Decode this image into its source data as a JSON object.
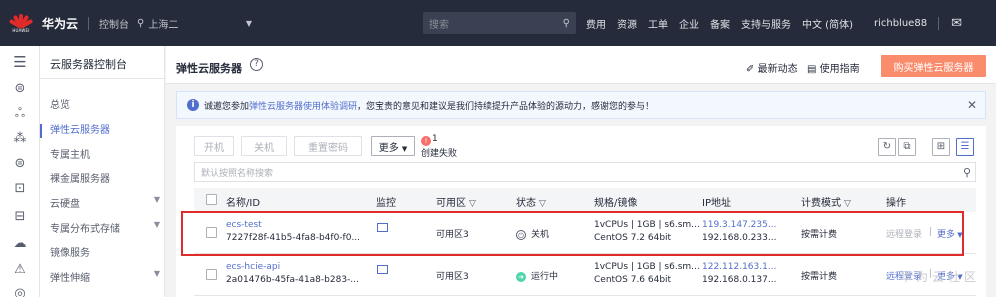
{
  "topbar": {
    "brand": "华为云",
    "console": "控制台",
    "region": "上海二",
    "search_placeholder": "搜索",
    "nav": [
      "费用",
      "资源",
      "工单",
      "企业",
      "备案",
      "支持与服务",
      "中文 (简体)"
    ],
    "user": "richblue88"
  },
  "sidebar": {
    "title": "云服务器控制台",
    "items": [
      {
        "label": "总览",
        "expandable": false
      },
      {
        "label": "弹性云服务器",
        "expandable": false
      },
      {
        "label": "专属主机",
        "expandable": false
      },
      {
        "label": "裸金属服务器",
        "expandable": false
      },
      {
        "label": "云硬盘",
        "expandable": true
      },
      {
        "label": "专属分布式存储",
        "expandable": true
      },
      {
        "label": "镜像服务",
        "expandable": false
      },
      {
        "label": "弹性伸缩",
        "expandable": true
      }
    ]
  },
  "header": {
    "title": "弹性云服务器",
    "news": "最新动态",
    "guide": "使用指南",
    "buy": "购买弹性云服务器"
  },
  "notice": {
    "prefix": "诚邀您参加",
    "link": "弹性云服务器使用体验调研",
    "suffix": "，您宝贵的意见和建议是我们持续提升产品体验的源动力，感谢您的参与！"
  },
  "toolbar": {
    "start": "开机",
    "stop": "关机",
    "reset_password": "重置密码",
    "more": "更多",
    "fail_count": "1",
    "fail_label": "创建失败"
  },
  "filter": {
    "placeholder": "默认按照名称搜索"
  },
  "table": {
    "columns": [
      "名称/ID",
      "监控",
      "可用区",
      "状态",
      "规格/镜像",
      "IP地址",
      "计费模式",
      "操作"
    ],
    "rows": [
      {
        "name": "ecs-test",
        "id": "7227f28f-41b5-4fa8-b4f0-f0...",
        "zone": "可用区3",
        "status": "关机",
        "spec": "1vCPUs | 1GB | s6.sm...",
        "image": "CentOS 7.2 64bit",
        "ip_public": "119.3.147.235...",
        "ip_private": "192.168.0.233...",
        "billing": "按需计费",
        "remote": "远程登录",
        "more": "更多"
      },
      {
        "name": "ecs-hcie-api",
        "id": "2a01476b-45fa-41a8-b283-...",
        "zone": "可用区3",
        "status": "运行中",
        "spec": "1vCPUs | 1GB | s6.sm...",
        "image": "CentOS 7.6 64bit",
        "ip_public": "122.112.163.1...",
        "ip_private": "192.168.0.137...",
        "billing": "按需计费",
        "remote": "远程登录",
        "more": "更多"
      }
    ]
  },
  "watermark": "华为云社区",
  "colors": {
    "topbar": "#252b3a",
    "accent": "#526ecc",
    "buy": "#fa8c6e",
    "highlight": "#e02b2b",
    "running": "#50d4ab"
  }
}
